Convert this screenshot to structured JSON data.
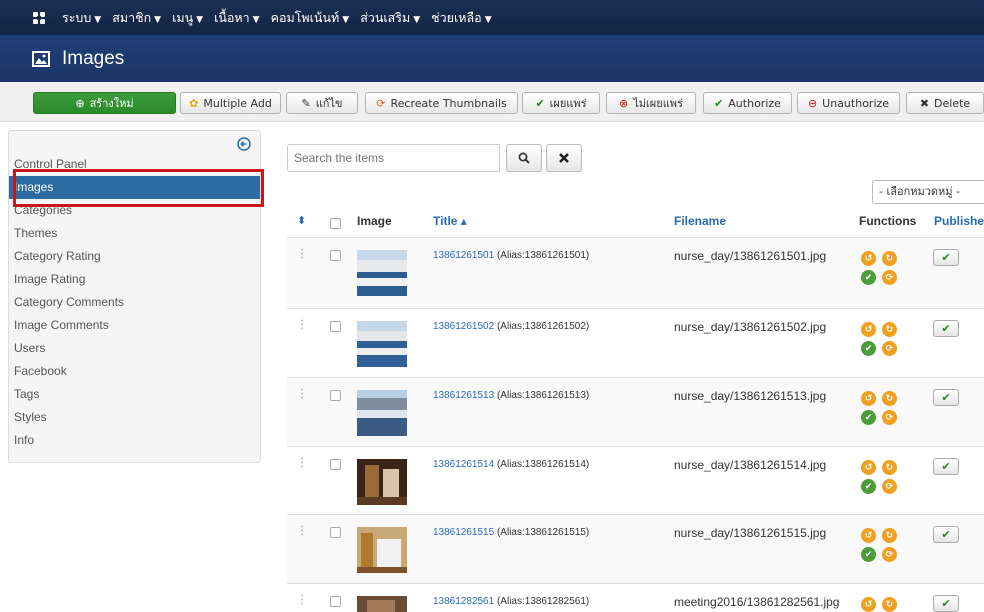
{
  "topnav": {
    "menu": [
      {
        "label": "ระบบ"
      },
      {
        "label": "สมาชิก"
      },
      {
        "label": "เมนู"
      },
      {
        "label": "เนื้อหา"
      },
      {
        "label": "คอมโพเน้นท์"
      },
      {
        "label": "ส่วนเสริม"
      },
      {
        "label": "ช่วยเหลือ"
      }
    ]
  },
  "header": {
    "title": "Images"
  },
  "toolbar": {
    "new": "สร้างใหม่",
    "multiple_add": "Multiple Add",
    "edit": "แก้ไข",
    "recreate": "Recreate Thumbnails",
    "publish": "เผยแพร่",
    "unpublish": "ไม่เผยแพร่",
    "authorize": "Authorize",
    "unauthorize": "Unauthorize",
    "delete": "Delete"
  },
  "sidebar": {
    "items": [
      {
        "label": "Control Panel"
      },
      {
        "label": "Images"
      },
      {
        "label": "Categories"
      },
      {
        "label": "Themes"
      },
      {
        "label": "Category Rating"
      },
      {
        "label": "Image Rating"
      },
      {
        "label": "Category Comments"
      },
      {
        "label": "Image Comments"
      },
      {
        "label": "Users"
      },
      {
        "label": "Facebook"
      },
      {
        "label": "Tags"
      },
      {
        "label": "Styles"
      },
      {
        "label": "Info"
      }
    ]
  },
  "search": {
    "placeholder": "Search the items"
  },
  "filter": {
    "category": "- เลือกหมวดหมู่ -"
  },
  "table": {
    "headers": {
      "order": "⬍",
      "image": "Image",
      "title": "Title ▴",
      "filename": "Filename",
      "functions": "Functions",
      "published": "Published"
    },
    "rows": [
      {
        "title": "13861261501",
        "alias": "(Alias:13861261501)",
        "filename": "nurse_day/13861261501.jpg"
      },
      {
        "title": "13861261502",
        "alias": "(Alias:13861261502)",
        "filename": "nurse_day/13861261502.jpg"
      },
      {
        "title": "13861261513",
        "alias": "(Alias:13861261513)",
        "filename": "nurse_day/13861261513.jpg"
      },
      {
        "title": "13861261514",
        "alias": "(Alias:13861261514)",
        "filename": "nurse_day/13861261514.jpg"
      },
      {
        "title": "13861261515",
        "alias": "(Alias:13861261515)",
        "filename": "nurse_day/13861261515.jpg"
      },
      {
        "title": "13861282561",
        "alias": "(Alias:13861282561)",
        "filename": "meeting2016/13861282561.jpg"
      }
    ]
  },
  "colors": {
    "topnav_bg": "#172b4d",
    "title_bg": "#1e3a6e",
    "active_sidebar": "#2d6ca2",
    "new_button": "#3d9d3d",
    "link": "#2a69b8",
    "highlight_box": "#c8171b"
  }
}
